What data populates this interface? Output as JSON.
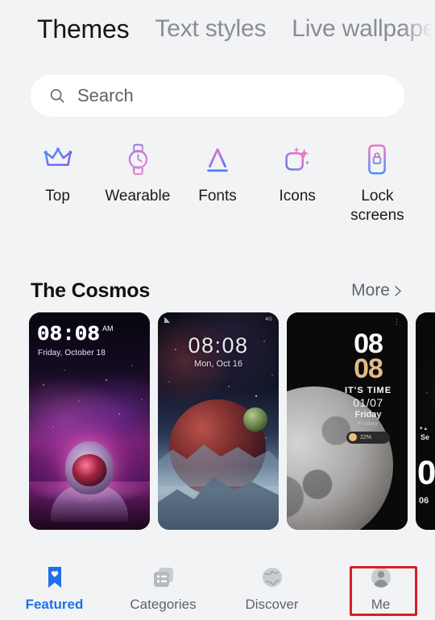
{
  "top_tabs": [
    {
      "label": "Themes",
      "active": true
    },
    {
      "label": "Text styles",
      "active": false
    },
    {
      "label": "Live wallpape",
      "active": false
    }
  ],
  "search": {
    "placeholder": "Search",
    "value": "",
    "icon": "search-icon"
  },
  "categories": [
    {
      "label": "Top",
      "icon": "crown-icon"
    },
    {
      "label": "Wearable",
      "icon": "watch-icon"
    },
    {
      "label": "Fonts",
      "icon": "font-a-icon"
    },
    {
      "label": "Icons",
      "icon": "sparkle-square-icon"
    },
    {
      "label": "Lock screens",
      "icon": "lock-phone-icon"
    }
  ],
  "section": {
    "title": "The Cosmos",
    "more_label": "More",
    "more_icon": "chevron-right-icon"
  },
  "theme_cards": [
    {
      "name": "astronaut-nebula",
      "time": "08:08",
      "ampm": "AM",
      "date": "Friday, October 18"
    },
    {
      "name": "planet-mountains",
      "time": "08:08",
      "date": "Mon, Oct 16",
      "status_right": "4G"
    },
    {
      "name": "moon",
      "hour": "08",
      "minute": "08",
      "tagline": "IT'S TIME",
      "date": "01/07",
      "day": "Friday",
      "day_small": "Friday",
      "battery": "22%"
    },
    {
      "name": "partial-card",
      "label_top": "Se",
      "big": "0",
      "small": "06"
    }
  ],
  "bottom_nav": [
    {
      "label": "Featured",
      "icon": "bookmark-heart-icon",
      "active": true,
      "highlighted": false
    },
    {
      "label": "Categories",
      "icon": "list-card-icon",
      "active": false,
      "highlighted": false
    },
    {
      "label": "Discover",
      "icon": "globe-icon",
      "active": false,
      "highlighted": false
    },
    {
      "label": "Me",
      "icon": "person-avatar-icon",
      "active": false,
      "highlighted": true
    }
  ],
  "colors": {
    "page_background": "#f2f3f5",
    "accent_blue": "#1f6fea",
    "muted_text": "#5f6368",
    "annotation_red": "#d61f26",
    "card_surface": "#ffffff"
  }
}
